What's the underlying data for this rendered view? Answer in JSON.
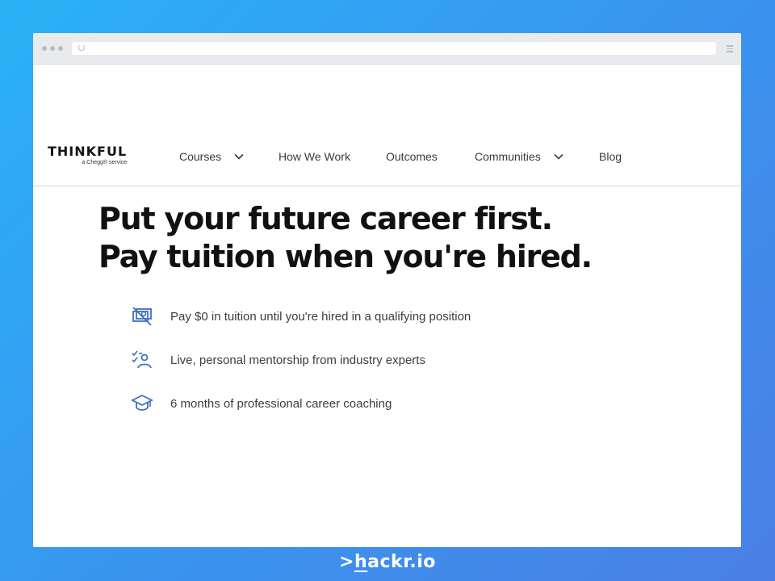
{
  "site": {
    "logo": {
      "name": "THINKFUL",
      "tagline": "a Chegg® service"
    },
    "nav": [
      {
        "label": "Courses",
        "has_dropdown": true
      },
      {
        "label": "How We Work",
        "has_dropdown": false
      },
      {
        "label": "Outcomes",
        "has_dropdown": false
      },
      {
        "label": "Communities",
        "has_dropdown": true
      },
      {
        "label": "Blog",
        "has_dropdown": false
      }
    ]
  },
  "hero": {
    "title_line1": "Put your future career first.",
    "title_line2": "Pay tuition when you're hired."
  },
  "features": [
    {
      "icon": "money-cancel-icon",
      "text": "Pay $0 in tuition until you're hired in a qualifying position"
    },
    {
      "icon": "mentor-checklist-icon",
      "text": "Live, personal mentorship from industry experts"
    },
    {
      "icon": "graduation-cap-icon",
      "text": "6 months of professional career coaching"
    }
  ],
  "brand": {
    "caret": ">",
    "h": "h",
    "rest": "ackr.io"
  },
  "colors": {
    "accent_icon": "#3f6fc2",
    "background_gradient_start": "#2ab2f5",
    "background_gradient_end": "#4b7fe6"
  }
}
